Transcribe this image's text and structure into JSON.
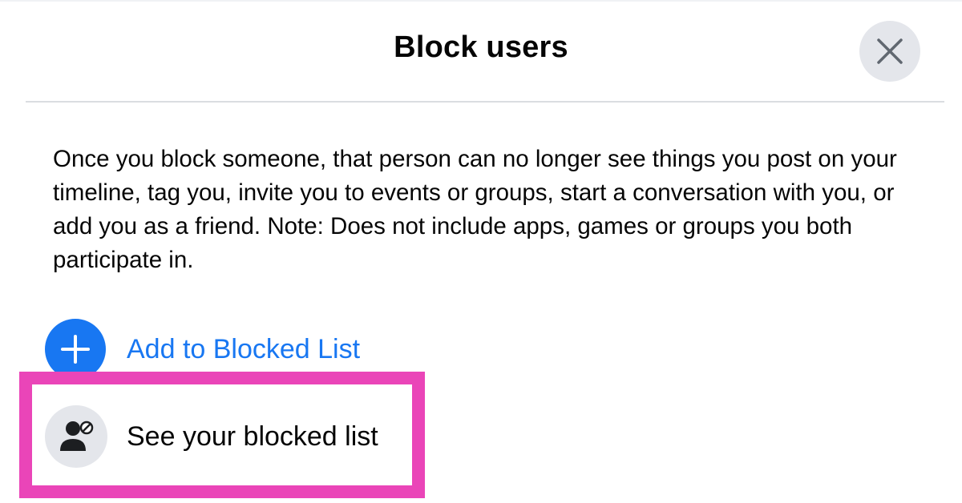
{
  "dialog": {
    "title": "Block users",
    "close_icon": "close-icon",
    "description": "Once you block someone, that person can no longer see things you post on your timeline, tag you, invite you to events or groups, start a conversation with you, or add you as a friend. Note: Does not include apps, games or groups you both participate in."
  },
  "actions": {
    "add_blocked": {
      "label": "Add to Blocked List",
      "icon": "plus-icon",
      "color": "#1877f2"
    },
    "see_blocked": {
      "label": "See your blocked list",
      "icon": "blocked-person-icon"
    }
  },
  "highlight_color": "#ea45b8"
}
